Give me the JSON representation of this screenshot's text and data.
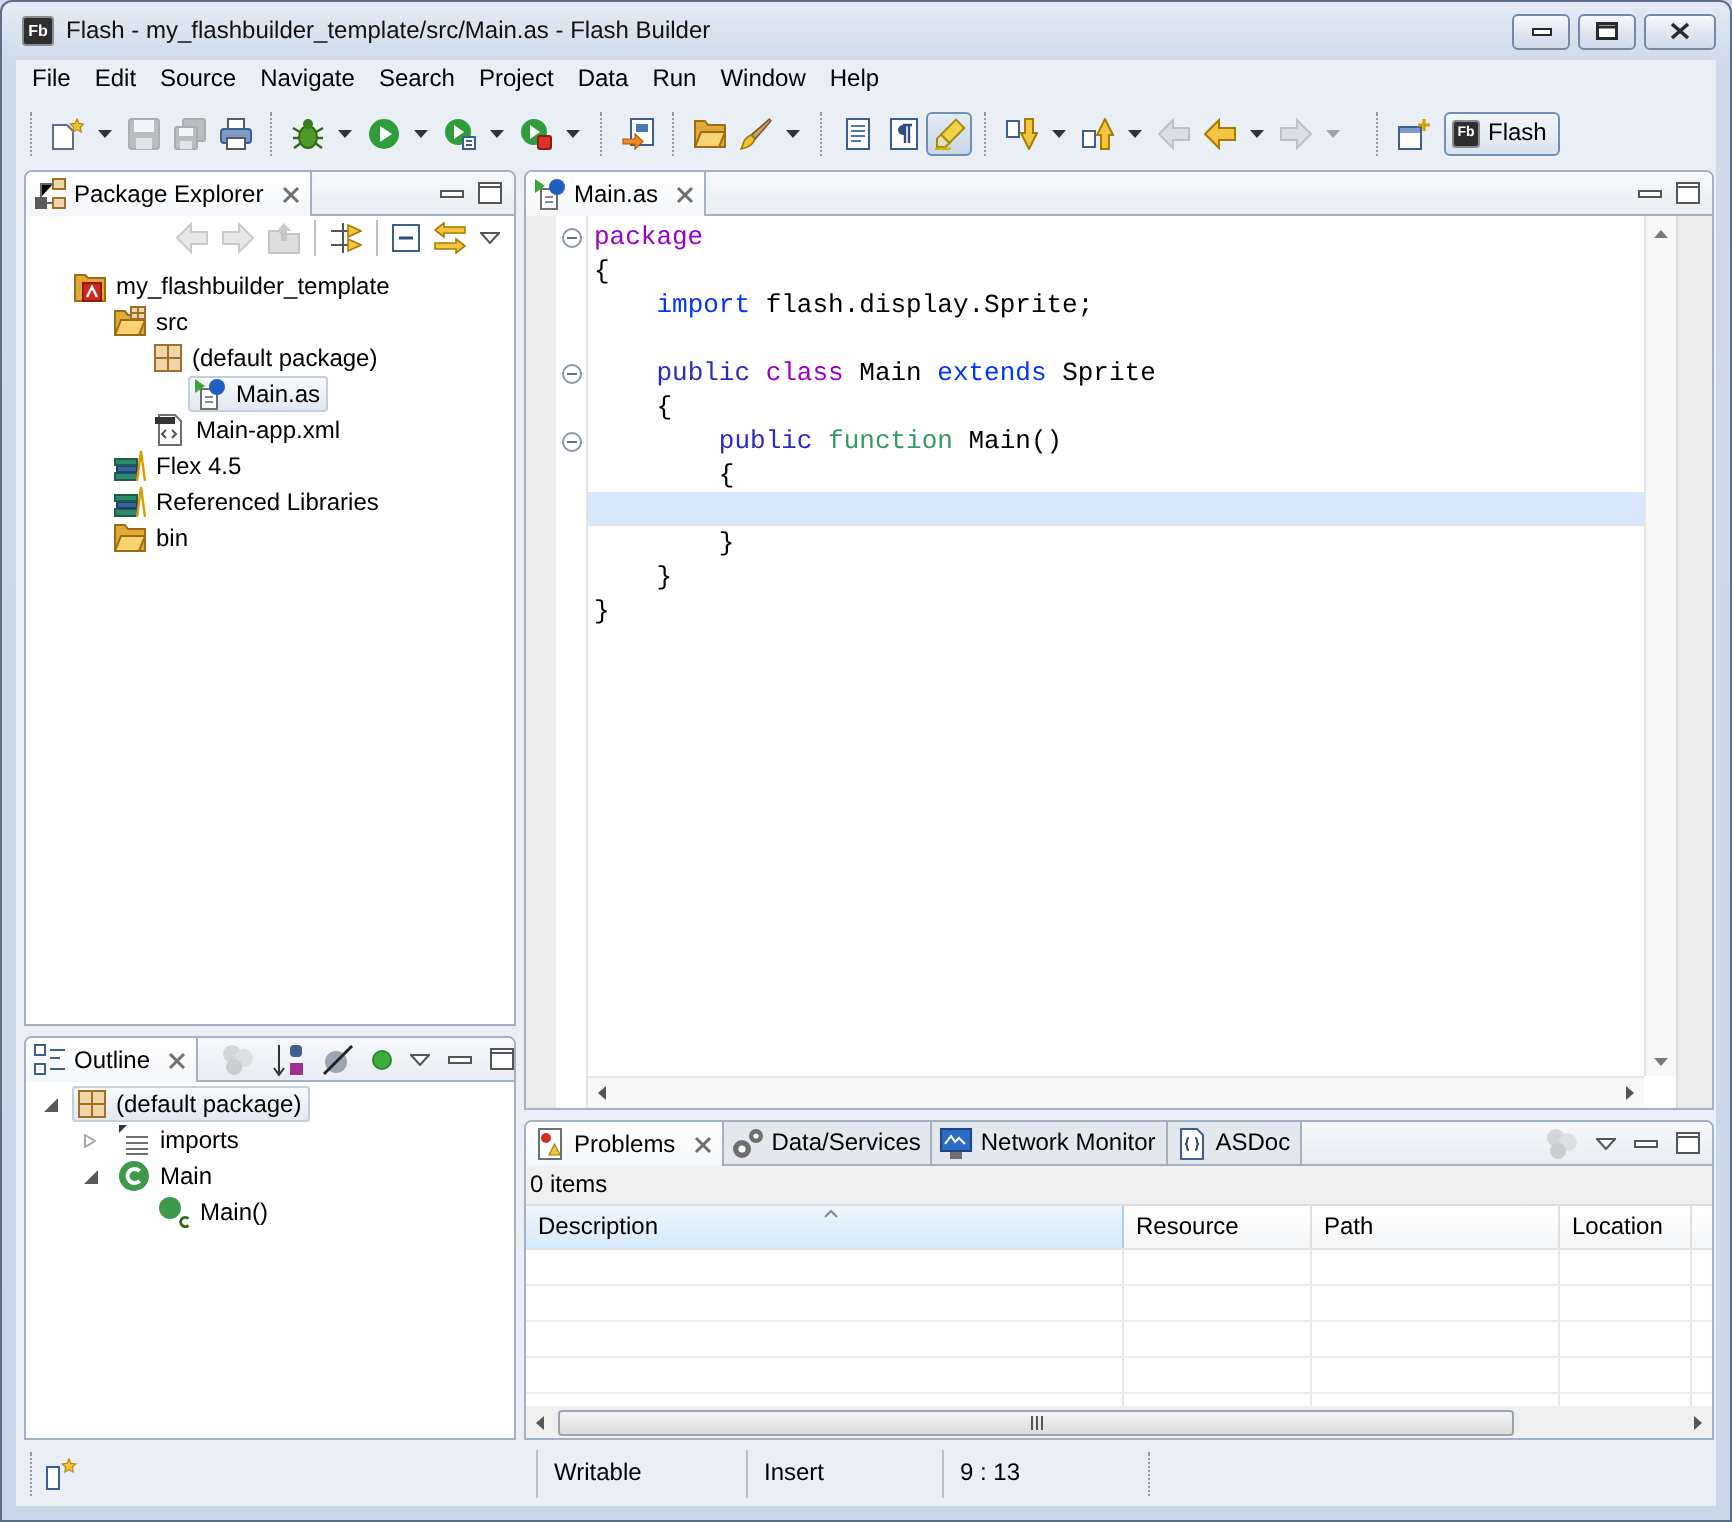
{
  "window": {
    "title": "Flash - my_flashbuilder_template/src/Main.as - Flash Builder",
    "logo_text": "Fb"
  },
  "menu": [
    "File",
    "Edit",
    "Source",
    "Navigate",
    "Search",
    "Project",
    "Data",
    "Run",
    "Window",
    "Help"
  ],
  "toolbar": {
    "groups": [
      [
        {
          "disabled": false,
          "dropdown": true,
          "pressed": false
        },
        {
          "disabled": true,
          "dropdown": false,
          "pressed": false
        },
        {
          "disabled": true,
          "dropdown": false,
          "pressed": false
        },
        {
          "disabled": false,
          "dropdown": false,
          "pressed": false
        }
      ],
      [
        {
          "disabled": false,
          "dropdown": true,
          "pressed": false
        },
        {
          "disabled": false,
          "dropdown": true,
          "pressed": false
        },
        {
          "disabled": false,
          "dropdown": true,
          "pressed": false
        },
        {
          "disabled": false,
          "dropdown": true,
          "pressed": false
        }
      ],
      [
        {
          "disabled": false,
          "dropdown": false,
          "pressed": false
        }
      ],
      [
        {
          "disabled": false,
          "dropdown": false,
          "pressed": false
        },
        {
          "disabled": false,
          "dropdown": true,
          "pressed": false
        }
      ],
      [
        {
          "disabled": false,
          "dropdown": false,
          "pressed": false
        },
        {
          "disabled": false,
          "dropdown": false,
          "pressed": false
        },
        {
          "disabled": false,
          "dropdown": false,
          "pressed": true
        }
      ],
      [
        {
          "disabled": false,
          "dropdown": true,
          "pressed": false
        },
        {
          "disabled": false,
          "dropdown": true,
          "pressed": false
        },
        {
          "disabled": true,
          "dropdown": false,
          "pressed": false
        },
        {
          "disabled": false,
          "dropdown": true,
          "pressed": false
        },
        {
          "disabled": true,
          "dropdown": true,
          "pressed": false
        }
      ]
    ],
    "perspectives": [
      {
        "label": "Flash",
        "logo_text": "Fb",
        "selected": true
      }
    ]
  },
  "package_explorer": {
    "tab": {
      "label": "Package Explorer",
      "selected": true
    },
    "view_toolbar": [
      [
        {
          "disabled": true
        },
        {
          "disabled": true
        },
        {
          "disabled": true
        }
      ],
      [
        {
          "disabled": false
        }
      ],
      [
        {
          "disabled": false
        },
        {
          "disabled": false
        }
      ]
    ],
    "tree": [
      {
        "label": "my_flashbuilder_template",
        "kind": "project",
        "selected": false,
        "children": [
          {
            "label": "src",
            "kind": "source-folder",
            "selected": false,
            "children": [
              {
                "label": "(default package)",
                "kind": "package",
                "selected": false,
                "children": [
                  {
                    "label": "Main.as",
                    "kind": "script-file",
                    "selected": true
                  }
                ]
              },
              {
                "label": "Main-app.xml",
                "kind": "xml-file",
                "selected": false
              }
            ]
          },
          {
            "label": "Flex 4.5",
            "kind": "library",
            "selected": false
          },
          {
            "label": "Referenced Libraries",
            "kind": "library",
            "selected": false
          },
          {
            "label": "bin",
            "kind": "folder",
            "selected": false
          }
        ]
      }
    ]
  },
  "outline": {
    "tab": {
      "label": "Outline",
      "selected": true
    },
    "view_toolbar": [
      {
        "disabled": true
      },
      {
        "disabled": false
      },
      {
        "disabled": false
      },
      {
        "disabled": false
      }
    ],
    "tree": [
      {
        "label": "(default package)",
        "kind": "package",
        "selected": true,
        "expanded": true,
        "children": [
          {
            "label": "imports",
            "kind": "imports",
            "selected": false,
            "expanded": false
          },
          {
            "label": "Main",
            "kind": "class",
            "selected": false,
            "expanded": true,
            "children": [
              {
                "label": "Main()",
                "kind": "constructor",
                "selected": false
              }
            ]
          }
        ]
      }
    ]
  },
  "editor": {
    "tabs": [
      {
        "label": "Main.as",
        "selected": true
      }
    ],
    "lines": [
      {
        "fold_marker": true,
        "current": false,
        "tokens": [
          {
            "text": "package",
            "color": "#9900cc"
          }
        ]
      },
      {
        "fold_marker": false,
        "current": false,
        "tokens": [
          {
            "text": "{"
          }
        ]
      },
      {
        "fold_marker": false,
        "current": false,
        "tokens": [
          {
            "text": "\timport",
            "color": "#0033ff"
          },
          {
            "text": " flash.display.Sprite;"
          }
        ]
      },
      {
        "fold_marker": false,
        "current": false
      },
      {
        "fold_marker": true,
        "current": false,
        "tokens": [
          {
            "text": "\tpublic",
            "color": "#2a2ac0"
          },
          {
            "text": " class",
            "color": "#9900cc"
          },
          {
            "text": " Main "
          },
          {
            "text": "extends",
            "color": "#0033ff"
          },
          {
            "text": " Sprite"
          }
        ]
      },
      {
        "fold_marker": false,
        "current": false,
        "tokens": [
          {
            "text": "\t{"
          }
        ]
      },
      {
        "fold_marker": true,
        "current": false,
        "tokens": [
          {
            "text": "\t\tpublic",
            "color": "#2a2ac0"
          },
          {
            "text": " function",
            "color": "#339966"
          },
          {
            "text": " Main()"
          }
        ]
      },
      {
        "fold_marker": false,
        "current": false,
        "tokens": [
          {
            "text": "\t\t{"
          }
        ]
      },
      {
        "fold_marker": false,
        "current": true
      },
      {
        "fold_marker": false,
        "current": false,
        "tokens": [
          {
            "text": "\t\t}"
          }
        ]
      },
      {
        "fold_marker": false,
        "current": false,
        "tokens": [
          {
            "text": "\t}"
          }
        ]
      },
      {
        "fold_marker": false,
        "current": false,
        "tokens": [
          {
            "text": "}"
          }
        ]
      }
    ]
  },
  "problems": {
    "tabs": [
      {
        "label": "Problems",
        "selected": true
      },
      {
        "label": "Data/Services",
        "selected": false
      },
      {
        "label": "Network Monitor",
        "selected": false
      },
      {
        "label": "ASDoc",
        "selected": false
      }
    ],
    "view_toolbar": [
      {
        "disabled": true
      }
    ],
    "summary": "0 items",
    "table": {
      "columns": [
        {
          "label": "Description",
          "sorted": true
        },
        {
          "label": "Resource",
          "sorted": false
        },
        {
          "label": "Path",
          "sorted": false
        },
        {
          "label": "Location",
          "sorted": false
        }
      ]
    }
  },
  "status_bar": {
    "fields": [
      "Writable",
      "Insert",
      "9 : 13"
    ]
  }
}
